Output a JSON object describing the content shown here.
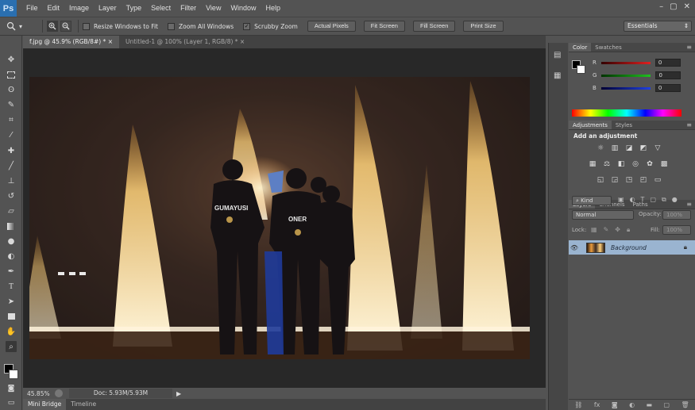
{
  "app": {
    "logo": "Ps"
  },
  "menu": [
    "File",
    "Edit",
    "Image",
    "Layer",
    "Type",
    "Select",
    "Filter",
    "View",
    "Window",
    "Help"
  ],
  "window_buttons": [
    "–",
    "▢",
    "✕"
  ],
  "options": {
    "checks": [
      {
        "label": "Resize Windows to Fit",
        "checked": false
      },
      {
        "label": "Zoom All Windows",
        "checked": false
      },
      {
        "label": "Scrubby Zoom",
        "checked": true
      }
    ],
    "buttons": [
      "Actual Pixels",
      "Fit Screen",
      "Fill Screen",
      "Print Size"
    ],
    "workspace": "Essentials"
  },
  "doc_tabs": [
    {
      "label": "f.jpg @ 45.9% (RGB/8#) *",
      "close": "×"
    },
    {
      "label": "Untitled-1 @ 100% (Layer 1, RGB/8) *",
      "close": "×"
    }
  ],
  "photo_text": {
    "jersey_left": "GUMAYUSI",
    "jersey_center": "ONER"
  },
  "status": {
    "zoom": "45.85%",
    "doc": "Doc: 5.93M/5.93M"
  },
  "bottom_tabs": [
    "Mini Bridge",
    "Timeline"
  ],
  "color_panel": {
    "tabs": [
      "Color",
      "Swatches"
    ],
    "channels": [
      {
        "label": "R",
        "value": "0",
        "color": "#e02020"
      },
      {
        "label": "G",
        "value": "0",
        "color": "#20c020"
      },
      {
        "label": "B",
        "value": "0",
        "color": "#2040e0"
      }
    ]
  },
  "adjustments_panel": {
    "tabs": [
      "Adjustments",
      "Styles"
    ],
    "heading": "Add an adjustment"
  },
  "layers_panel": {
    "tabs": [
      "Layers",
      "Channels",
      "Paths"
    ],
    "kind": "Kind",
    "blend_mode": "Normal",
    "opacity_label": "Opacity:",
    "opacity_value": "100%",
    "lock_label": "Lock:",
    "fill_label": "Fill:",
    "fill_value": "100%",
    "layer_name": "Background"
  }
}
